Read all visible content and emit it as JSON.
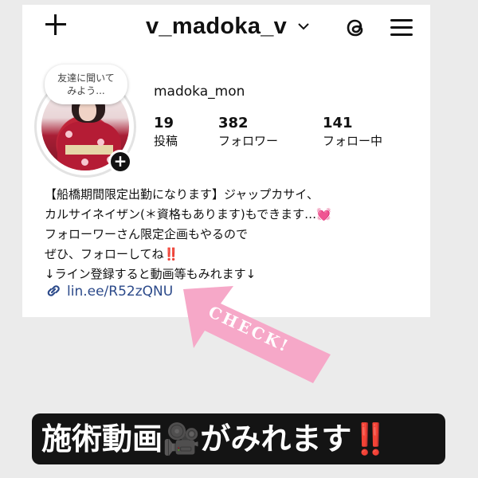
{
  "header": {
    "username": "v_madoka_v",
    "icons": [
      "add-icon",
      "chevron-down-icon",
      "threads-icon",
      "menu-icon"
    ]
  },
  "profile": {
    "note_bubble": [
      "友達に聞いて",
      "みよう..."
    ],
    "display_name": "madoka_mon",
    "stats": [
      {
        "value": "19",
        "label": "投稿"
      },
      {
        "value": "382",
        "label": "フォロワー"
      },
      {
        "value": "141",
        "label": "フォロー中"
      }
    ]
  },
  "bio": {
    "line1": "【船橋期間限定出勤になります】ジャップカサイ、",
    "line2": "カルサイネイザン(＊資格もあります)もできます…",
    "line2_emoji": "💓",
    "line3": "フォローワーさん限定企画もやるので",
    "line4": "ぜひ、フォローしてね",
    "line4_emoji": "‼️",
    "line5": "↓ライン登録すると動画等もみれます↓",
    "link": "lin.ee/R52zQNU"
  },
  "annotation": {
    "arrow_text": "CHECK!",
    "arrow_color": "#f6a8c8"
  },
  "banner": {
    "text": "施術動画",
    "emoji": "🎥",
    "text2": "がみれます",
    "emoji2": "‼️"
  },
  "colors": {
    "link": "#2c4a8a",
    "banner_bg": "#141414",
    "accent_red": "#e0182d"
  }
}
